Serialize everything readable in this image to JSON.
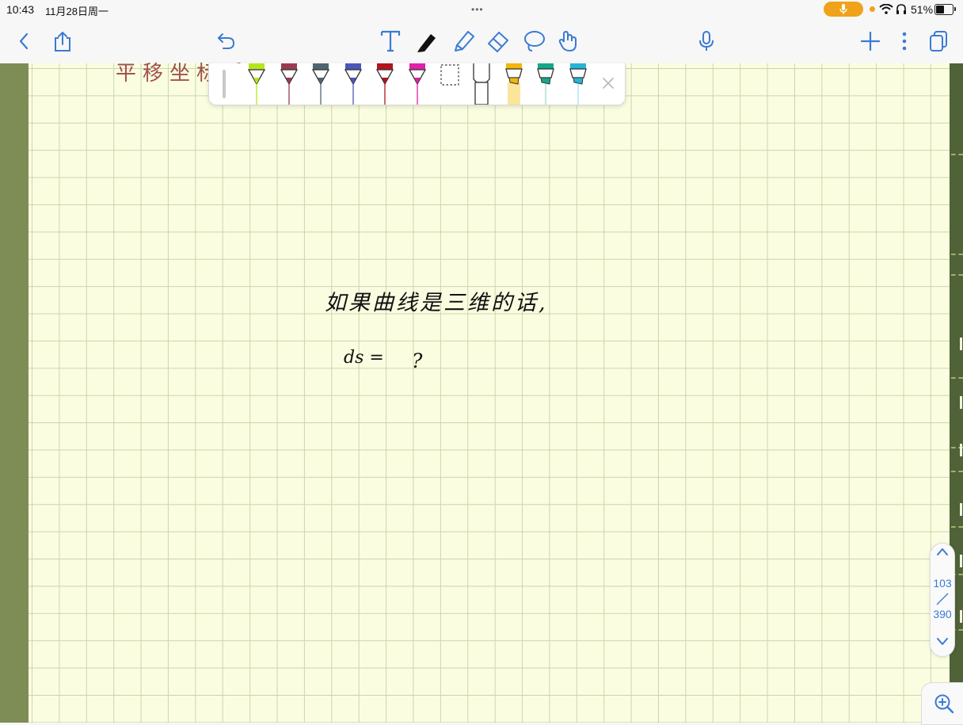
{
  "status": {
    "time": "10:43",
    "date": "11月28日周一",
    "dots": "•••",
    "battery": "51%"
  },
  "toolbar": {
    "back_icon": "chevron-left-icon",
    "share_icon": "share-icon",
    "undo_icon": "undo-icon",
    "tools": [
      "text-tool-icon",
      "pen-tool-icon",
      "highlighter-tool-icon",
      "eraser-tool-icon",
      "lasso-tool-icon",
      "hand-tool-icon"
    ],
    "right": [
      "microphone-icon",
      "add-icon",
      "more-icon",
      "pages-icon"
    ]
  },
  "pen_tray": {
    "pens": [
      {
        "name": "lime",
        "color": "#b5e61d"
      },
      {
        "name": "maroon",
        "color": "#9b3b52"
      },
      {
        "name": "slate",
        "color": "#4e6670"
      },
      {
        "name": "indigo",
        "color": "#4b57b8"
      },
      {
        "name": "red",
        "color": "#b3141c"
      },
      {
        "name": "magenta",
        "color": "#e020a8"
      }
    ],
    "highlighters": [
      {
        "name": "yellow",
        "color": "#f2b70c"
      },
      {
        "name": "teal",
        "color": "#13a78b"
      },
      {
        "name": "cyan",
        "color": "#25b5d6"
      }
    ]
  },
  "note": {
    "heading": "平移坐标系",
    "line1": "如果曲线是三维的话,",
    "line2": "ds =",
    "line2_q": "?"
  },
  "page_nav": {
    "current": "103",
    "total": "390"
  }
}
